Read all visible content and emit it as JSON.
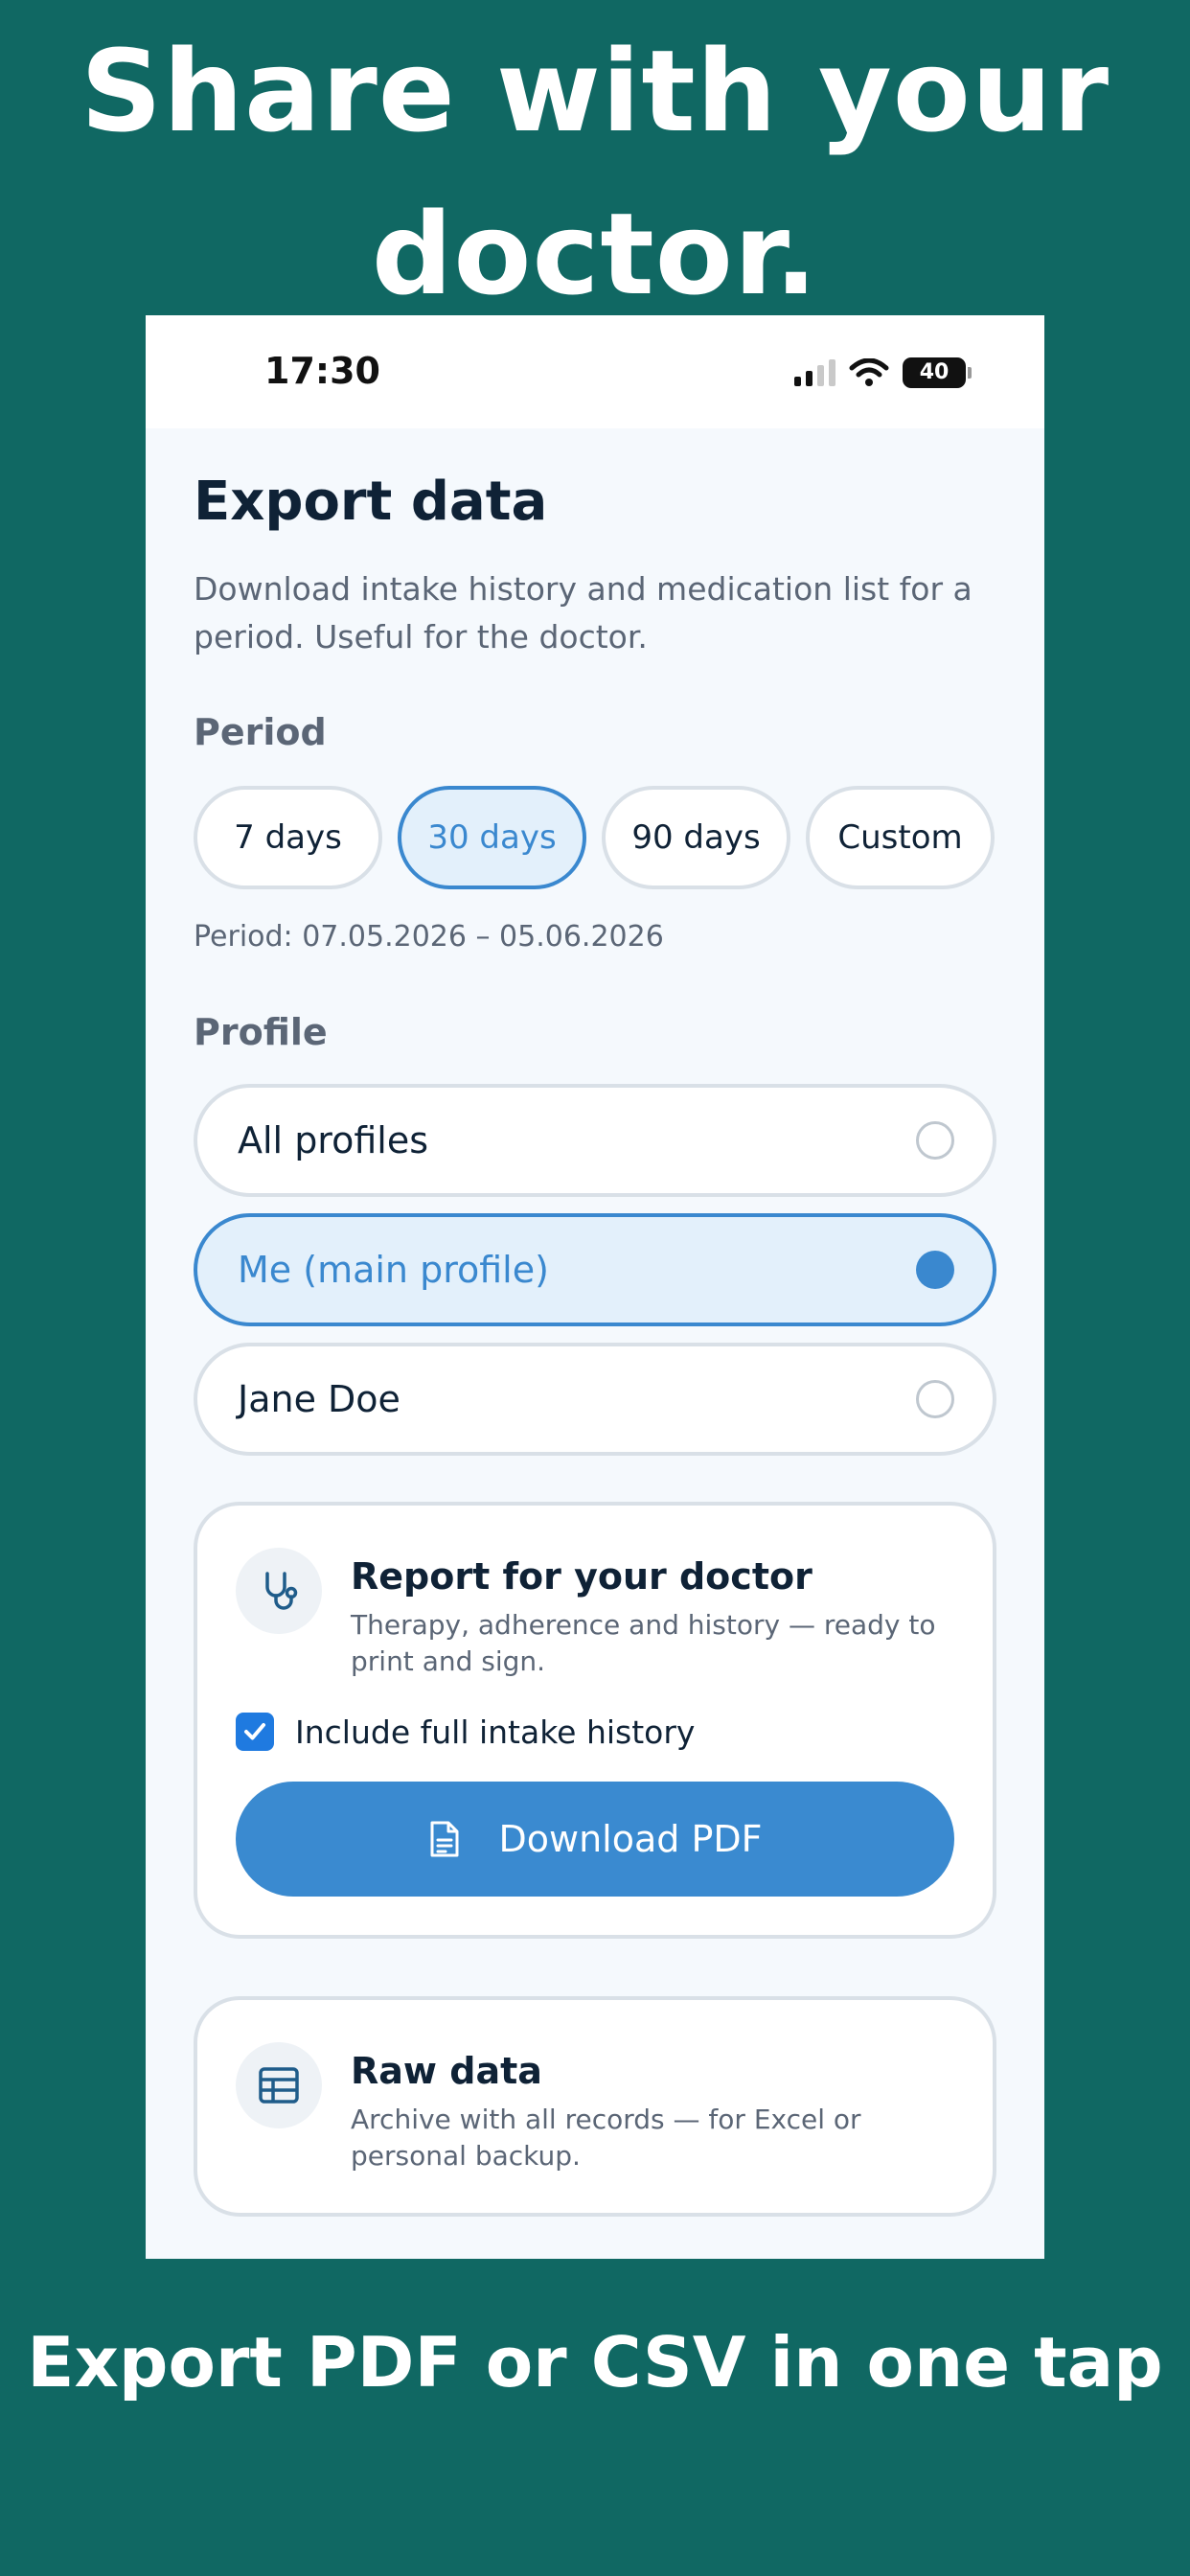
{
  "promo": {
    "headline": "Share with your doctor.",
    "caption": "Export PDF or CSV in one tap"
  },
  "status_bar": {
    "time": "17:30",
    "battery": "40"
  },
  "page": {
    "title": "Export data",
    "description": "Download intake history and medication list for a period. Useful for the doctor."
  },
  "period": {
    "label": "Period",
    "options": [
      "7 days",
      "30 days",
      "90 days",
      "Custom"
    ],
    "selected": "30 days",
    "range_text": "Period: 07.05.2026 – 05.06.2026"
  },
  "profile": {
    "label": "Profile",
    "options": [
      "All profiles",
      "Me (main profile)",
      "Jane Doe"
    ],
    "selected": "Me (main profile)"
  },
  "doctor_report": {
    "icon": "stethoscope-icon",
    "title": "Report for your doctor",
    "subtitle": "Therapy, adherence and history — ready to print and sign.",
    "checkbox_label": "Include full intake history",
    "checkbox_checked": true,
    "button_label": "Download PDF"
  },
  "raw_data": {
    "icon": "table-icon",
    "title": "Raw data",
    "subtitle": "Archive with all records — for Excel or personal backup."
  },
  "colors": {
    "background": "#106863",
    "accent": "#3a88cf"
  }
}
